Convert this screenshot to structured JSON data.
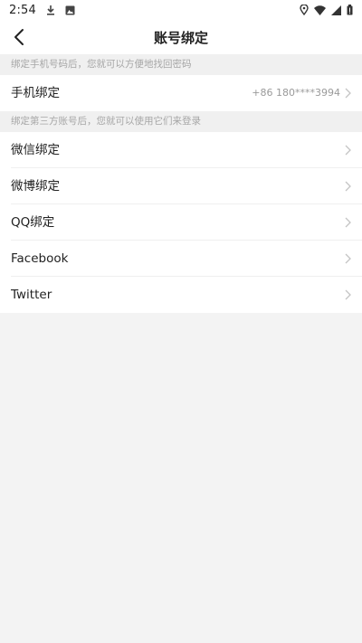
{
  "status_bar": {
    "time": "2:54",
    "icons_left": [
      "download-icon",
      "photo-icon"
    ],
    "icons_right": [
      "location-icon",
      "wifi-icon",
      "signal-icon",
      "battery-icon"
    ]
  },
  "nav": {
    "title": "账号绑定",
    "back_icon": "back-chevron-icon"
  },
  "phone_section": {
    "hint": "绑定手机号码后，您就可以方便地找回密码",
    "row": {
      "label": "手机绑定",
      "value": "+86 180****3994"
    }
  },
  "third_party_section": {
    "hint": "绑定第三方账号后，您就可以使用它们来登录",
    "items": [
      {
        "label": "微信绑定"
      },
      {
        "label": "微博绑定"
      },
      {
        "label": "QQ绑定"
      },
      {
        "label": "Facebook"
      },
      {
        "label": "Twitter"
      }
    ]
  },
  "colors": {
    "background": "#f3f3f3",
    "row_background": "#ffffff",
    "hint_text": "#a6a6a6",
    "value_text": "#9a9a9a"
  }
}
